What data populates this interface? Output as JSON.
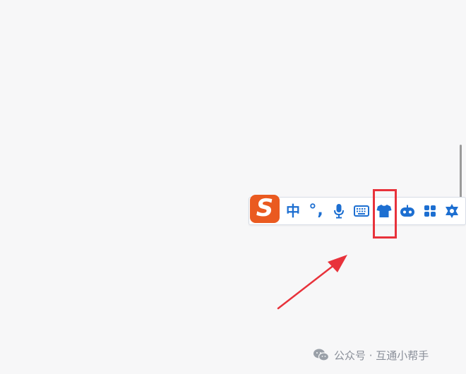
{
  "ime_toolbar": {
    "logo_letter": "S",
    "mode_label": "中",
    "punct_label": "°,",
    "items": [
      {
        "icon": "s-logo-icon"
      },
      {
        "icon": "chinese-mode-toggle"
      },
      {
        "icon": "punctuation-toggle"
      },
      {
        "icon": "microphone-icon"
      },
      {
        "icon": "keyboard-icon"
      },
      {
        "icon": "tshirt-skin-icon"
      },
      {
        "icon": "robot-icon"
      },
      {
        "icon": "grid-apps-icon"
      },
      {
        "icon": "settings-icon"
      }
    ],
    "colors": {
      "logo_bg": "#ea5a20",
      "icon": "#1d6fd1",
      "highlight": "#e8323b",
      "arrow": "#e8323b"
    }
  },
  "watermark": {
    "text": "公众号 · 互通小帮手"
  }
}
